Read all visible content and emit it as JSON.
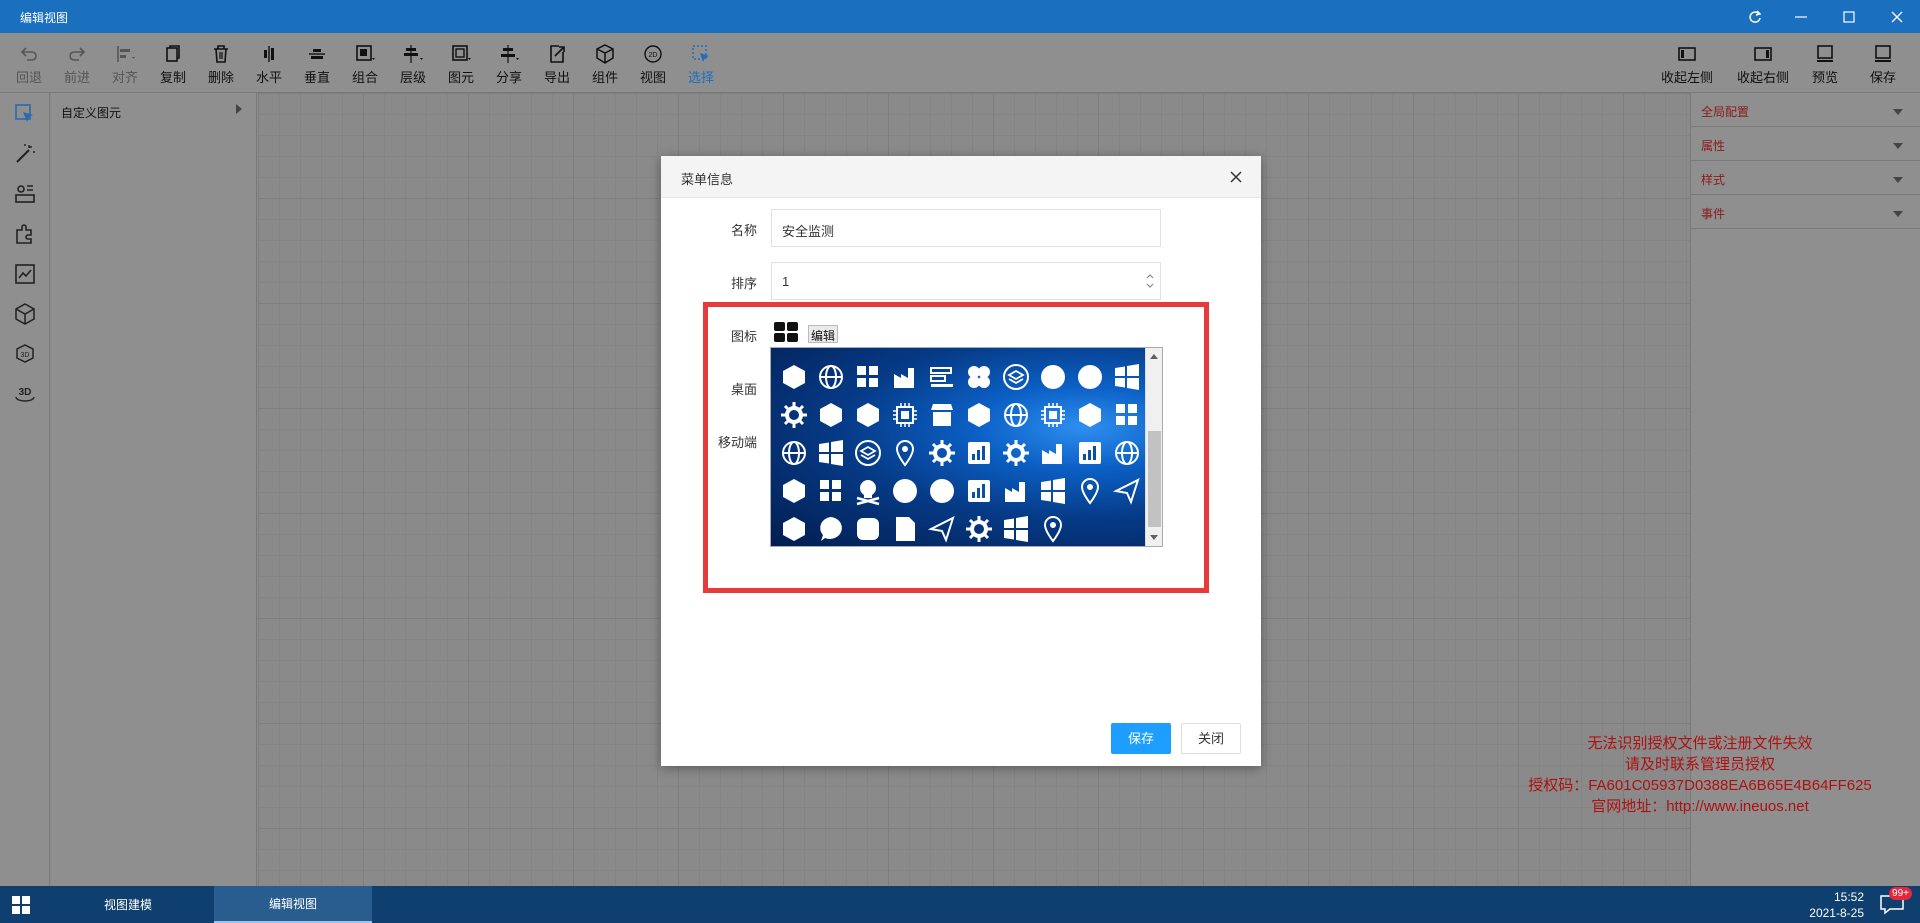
{
  "window": {
    "title": "编辑视图"
  },
  "toolbar": {
    "undo": "回退",
    "redo": "前进",
    "align": "对齐",
    "copy": "复制",
    "delete": "删除",
    "horizontal": "水平",
    "vertical": "垂直",
    "group": "组合",
    "layer": "层级",
    "element": "图元",
    "share": "分享",
    "export": "导出",
    "component": "组件",
    "view": "视图",
    "select": "选择",
    "collapse_left": "收起左侧",
    "collapse_right": "收起右侧",
    "preview": "预览",
    "save": "保存"
  },
  "left_panel": {
    "header": "自定义图元"
  },
  "right_panel": {
    "items": [
      "全局配置",
      "属性",
      "样式",
      "事件"
    ]
  },
  "dialog": {
    "title": "菜单信息",
    "name_label": "名称",
    "name_value": "安全监测",
    "order_label": "排序",
    "order_value": "1",
    "icon_label": "图标",
    "edit_label": "编辑",
    "desktop_label": "桌面",
    "mobile_label": "移动端",
    "save_label": "保存",
    "close_label": "关闭"
  },
  "warning": {
    "line1": "无法识别授权文件或注册文件失效",
    "line2": "请及时联系管理员授权",
    "line3": "授权码：FA601C05937D0388EA6B65E4B64FF625",
    "line4": "官网地址：http://www.ineuos.net"
  },
  "taskbar": {
    "task1": "视图建模",
    "task2": "编辑视图",
    "time": "15:52",
    "date": "2021-8-25",
    "badge": "99+"
  },
  "colors": {
    "titlebar": "#1a6fbf",
    "highlight": "#e83a3a",
    "primary_button": "#1e9fff",
    "warning_text": "#b01010"
  }
}
